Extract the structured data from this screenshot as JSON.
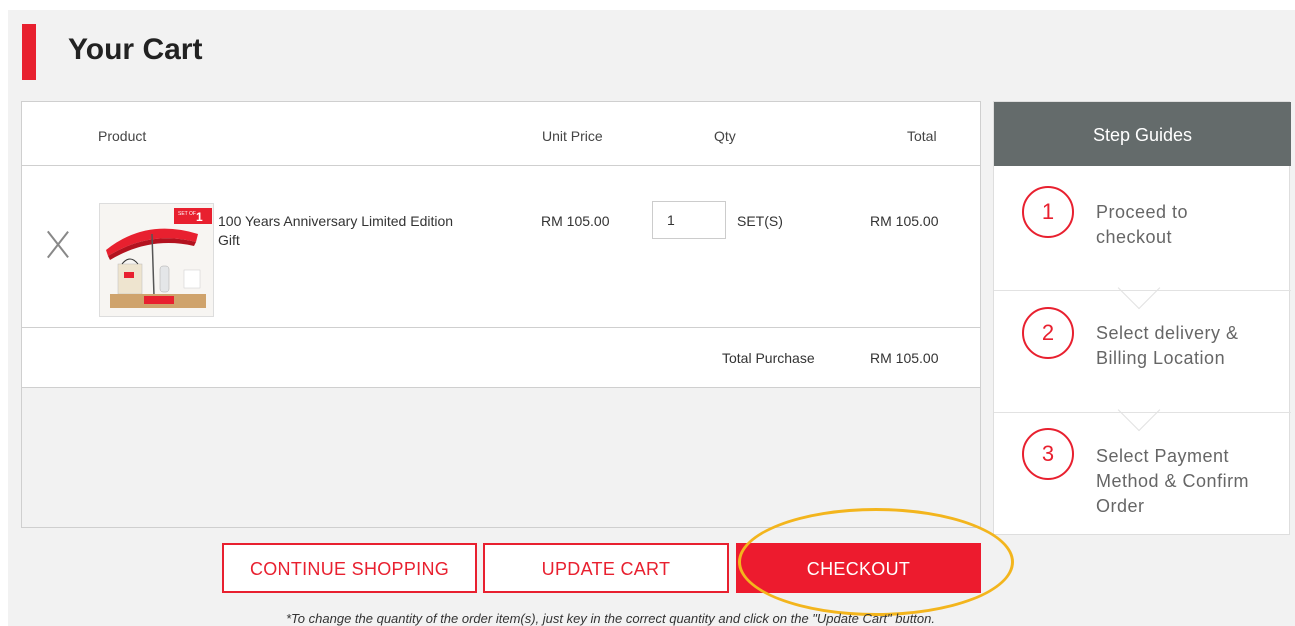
{
  "page": {
    "title": "Your Cart"
  },
  "cart": {
    "columns": {
      "product": "Product",
      "unit_price": "Unit Price",
      "qty": "Qty",
      "total": "Total"
    },
    "items": [
      {
        "name": "100 Years Anniversary Limited Edition Gift",
        "unit_price": "RM 105.00",
        "qty": "1",
        "unit": "SET(S)",
        "total": "RM 105.00",
        "badge": {
          "top": "SET OF",
          "num": "1"
        }
      }
    ],
    "total_label": "Total Purchase",
    "total_value": "RM 105.00"
  },
  "steps": {
    "heading": "Step Guides",
    "items": [
      {
        "num": "1",
        "line1": "Proceed to",
        "line2": "checkout",
        "line3": ""
      },
      {
        "num": "2",
        "line1": "Select delivery &",
        "line2": "Billing Location",
        "line3": ""
      },
      {
        "num": "3",
        "line1": "Select Payment",
        "line2": "Method & Confirm",
        "line3": "Order"
      }
    ]
  },
  "buttons": {
    "continue": "CONTINUE SHOPPING",
    "update": "UPDATE CART",
    "checkout": "CHECKOUT"
  },
  "note": "*To change the quantity of the order item(s), just key in the correct quantity and click on the \"Update Cart\" button.",
  "colors": {
    "accent": "#e8202f",
    "step_header": "#646b6b",
    "highlight": "#f3b51d"
  }
}
